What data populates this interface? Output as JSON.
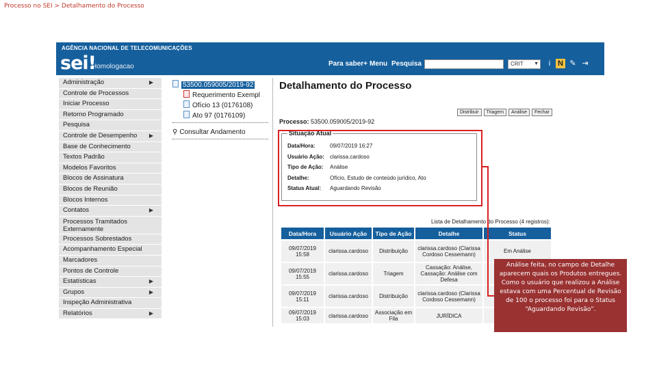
{
  "slide_title": "Processo no SEI > Detalhamento do Processo",
  "header": {
    "agency": "AGÊNCIA NACIONAL DE TELECOMUNICAÇÕES",
    "logo": "sei!",
    "environment": "Homologacao",
    "nav": [
      "Para saber+",
      "Menu",
      "Pesquisa"
    ],
    "search_value": "",
    "unit_select": "CRIT",
    "icons": [
      "info-icon",
      "notice-icon",
      "tools-icon",
      "exit-icon"
    ]
  },
  "menu": {
    "items": [
      {
        "label": "Administração",
        "caret": true
      },
      {
        "label": "Controle de Processos",
        "caret": false
      },
      {
        "label": "Iniciar Processo",
        "caret": false
      },
      {
        "label": "Retorno Programado",
        "caret": false
      },
      {
        "label": "Pesquisa",
        "caret": false
      },
      {
        "label": "Controle de Desempenho",
        "caret": true
      },
      {
        "label": "Base de Conhecimento",
        "caret": false
      },
      {
        "label": "Textos Padrão",
        "caret": false
      },
      {
        "label": "Modelos Favoritos",
        "caret": false
      },
      {
        "label": "Blocos de Assinatura",
        "caret": false
      },
      {
        "label": "Blocos de Reunião",
        "caret": false
      },
      {
        "label": "Blocos Internos",
        "caret": false
      },
      {
        "label": "Contatos",
        "caret": true
      },
      {
        "label": "Processos Tramitados Externamente",
        "caret": false,
        "tall": true
      },
      {
        "label": "Processos Sobrestados",
        "caret": false
      },
      {
        "label": "Acompanhamento Especial",
        "caret": false
      },
      {
        "label": "Marcadores",
        "caret": false
      },
      {
        "label": "Pontos de Controle",
        "caret": false
      },
      {
        "label": "Estatísticas",
        "caret": true
      },
      {
        "label": "Grupos",
        "caret": true
      },
      {
        "label": "Inspeção Administrativa",
        "caret": false
      },
      {
        "label": "Relatórios",
        "caret": true
      }
    ]
  },
  "tree": {
    "root": "53500.059005/2019-92",
    "docs": [
      {
        "label": "Requerimento Exempl",
        "type": "pdf"
      },
      {
        "label": "Ofício 13 (0176108)",
        "type": "doc"
      },
      {
        "label": "Ato 97 (0176109)",
        "type": "doc"
      }
    ],
    "consult": "Consultar Andamento"
  },
  "detail": {
    "title": "Detalhamento do Processo",
    "actions": [
      "Distribuir",
      "Triagem",
      "Análise",
      "Fechar"
    ],
    "process_label": "Processo:",
    "process_number": "53500.059005/2019-92",
    "situation": {
      "legend": "Situação Atual",
      "rows": [
        {
          "key": "Data/Hora:",
          "value": "09/07/2019 16:27"
        },
        {
          "key": "Usuário Ação:",
          "value": "clarissa.cardoso"
        },
        {
          "key": "Tipo de Ação:",
          "value": "Análise"
        },
        {
          "key": "Detalhe:",
          "value": "Ofício, Estudo de conteúdo jurídico, Ato"
        },
        {
          "key": "Status Atual:",
          "value": "Aguardando Revisão"
        }
      ]
    },
    "list_caption": "Lista de Detalhamento do Processo (4 registros):",
    "table": {
      "headers": [
        "Data/Hora",
        "Usuário Ação",
        "Tipo de Ação",
        "Detalhe",
        "Status"
      ],
      "rows": [
        [
          "09/07/2019 15:58",
          "clarissa.cardoso",
          "Distribuição",
          "clarissa.cardoso (Clarissa Cordoso Cessemann)",
          "Em Análise"
        ],
        [
          "09/07/2019 15:55",
          "clarissa.cardoso",
          "Triagem",
          "Cassação: Análise, Cassação: Análise com Defesa",
          ""
        ],
        [
          "09/07/2019 15:11",
          "clarissa.cardoso",
          "Distribuição",
          "clarissa.cardoso (Clarissa Cordoso Cessemann)",
          ""
        ],
        [
          "09/07/2019 15:03",
          "clarissa.cardoso",
          "Associação em Fila",
          "JURÍDICA",
          ""
        ]
      ]
    }
  },
  "callout": "Análise feita, no campo de Detalhe aparecem quais os Produtos entregues. Como o usuário que realizou a Análise estava com uma Percentual de Revisão de 100 o processo foi para o Status “Aguardando Revisão”.",
  "colors": {
    "brand": "#155f9d",
    "highlight": "#d91f1f",
    "callout_bg": "#9a3232"
  }
}
